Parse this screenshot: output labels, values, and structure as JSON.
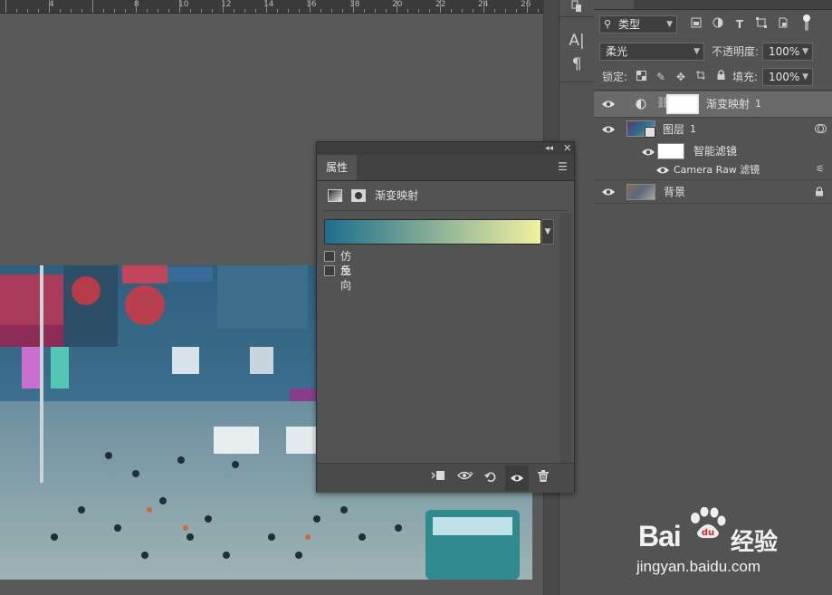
{
  "ruler": {
    "labels": [
      "4",
      "8",
      "10",
      "12",
      "14",
      "16",
      "18",
      "20",
      "22",
      "24",
      "26"
    ]
  },
  "layers_panel": {
    "filter_kind": "类型",
    "blend_mode": "柔光",
    "opacity_label": "不透明度:",
    "opacity_value": "100%",
    "lock_label": "锁定:",
    "fill_label": "填充:",
    "fill_value": "100%",
    "layers": [
      {
        "name": "渐变映射",
        "suffix": "1"
      },
      {
        "name": "图层",
        "suffix": "1"
      },
      {
        "name": "智能滤镜"
      },
      {
        "name": "Camera Raw 滤镜"
      },
      {
        "name": "背景"
      }
    ]
  },
  "properties_panel": {
    "tab_label": "属性",
    "adjustment_title": "渐变映射",
    "gradient": {
      "start_color": "#1d6d8e",
      "end_color": "#f2f0a0"
    },
    "checkboxes": [
      {
        "label": "仿色",
        "checked": false
      },
      {
        "label": "反向",
        "checked": false
      }
    ]
  },
  "watermark": {
    "brand_left": "Bai",
    "brand_right": "经验",
    "url": "jingyan.baidu.com"
  },
  "colors": {
    "panel_bg": "#535353",
    "selected_layer": "#6a6a6a",
    "watermark_red": "#d8262b"
  }
}
